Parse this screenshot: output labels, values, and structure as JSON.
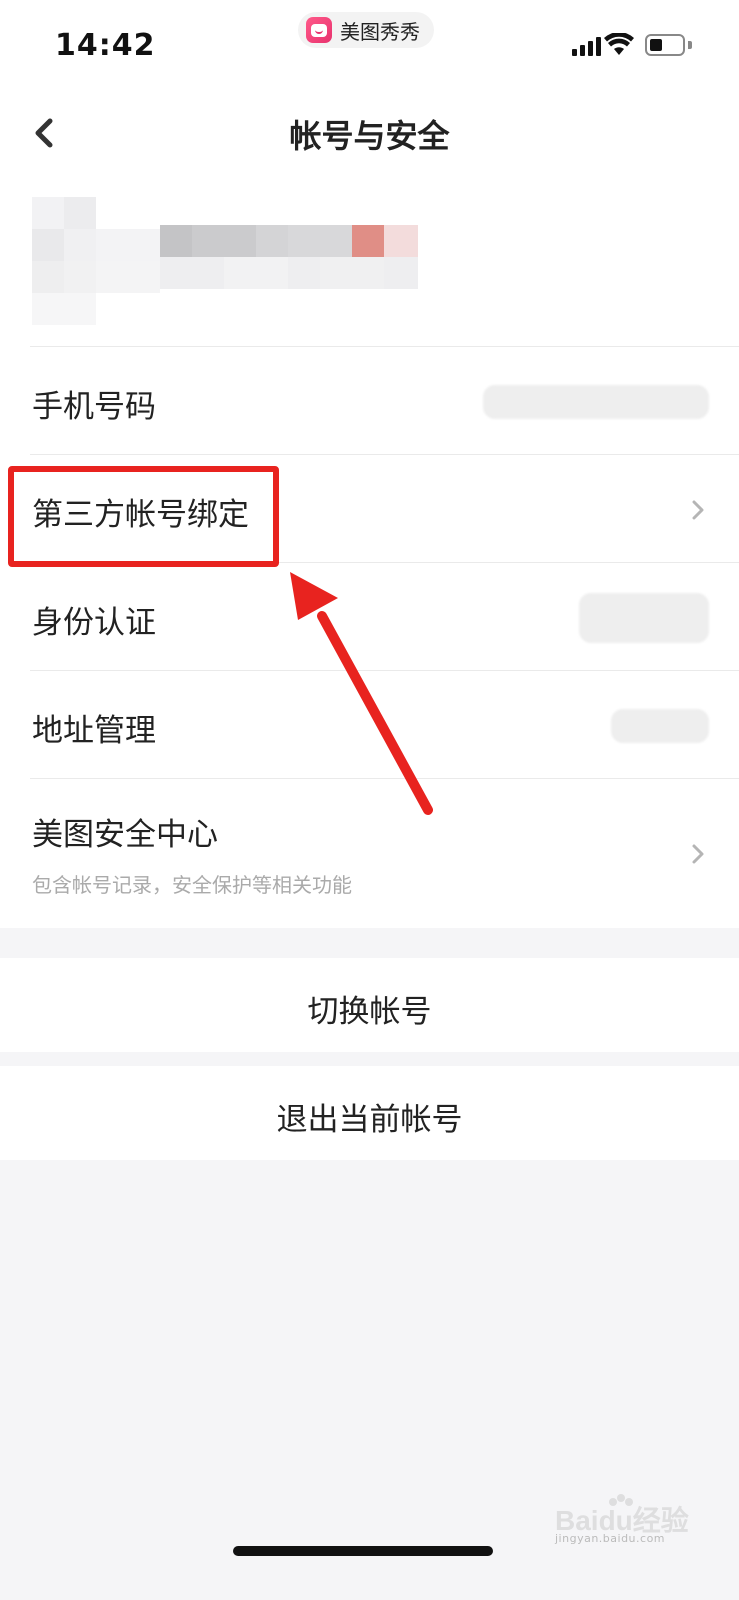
{
  "status_bar": {
    "time": "14:42",
    "app_name": "美图秀秀",
    "signal_icon": "cellular-signal-icon",
    "wifi_icon": "wifi-icon",
    "battery_icon": "battery-icon"
  },
  "nav": {
    "back_icon": "chevron-left-icon",
    "title": "帐号与安全"
  },
  "rows": [
    {
      "label": "手机号码",
      "value_hidden": true
    },
    {
      "label": "第三方帐号绑定",
      "chevron": true
    },
    {
      "label": "身份认证",
      "value_hidden": true
    },
    {
      "label": "地址管理",
      "value_hidden": true
    },
    {
      "label": "美图安全中心",
      "sub": "包含帐号记录，安全保护等相关功能",
      "chevron": true
    }
  ],
  "actions": {
    "switch_account": "切换帐号",
    "logout": "退出当前帐号"
  },
  "annotation": {
    "highlight_color": "#e8231f"
  },
  "watermark": {
    "brand": "Baidu经验",
    "url": "jingyan.baidu.com"
  }
}
